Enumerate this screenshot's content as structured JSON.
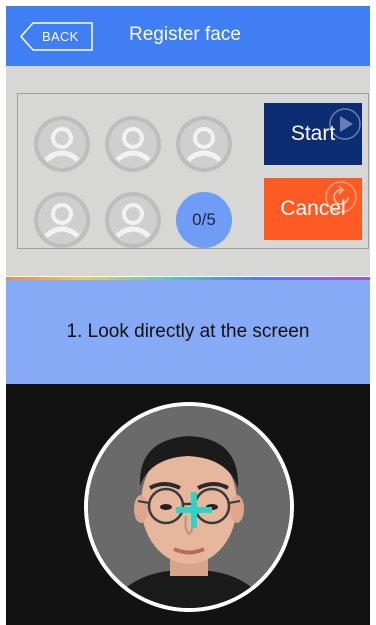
{
  "header": {
    "back_label": "BACK",
    "title": "Register face"
  },
  "capture": {
    "slots_total": 5,
    "captured": 0,
    "counter_text": "0/5"
  },
  "buttons": {
    "start_label": "Start",
    "cancel_label": "Cancel"
  },
  "instruction": {
    "text": "1. Look directly at the screen"
  },
  "icons": {
    "back": "back-arrow-icon",
    "slot": "person-avatar-icon",
    "start_overlay": "play-icon",
    "cancel_overlay": "refresh-icon",
    "crosshair": "crosshair-icon"
  },
  "colors": {
    "header": "#3f7ef3",
    "panel": "#d7d7d6",
    "start_button": "#0d2d72",
    "cancel_button": "#fd5a24",
    "counter": "#6f9cf4",
    "instruction_band": "#86aaf6",
    "camera_bg": "#121212",
    "crosshair": "#2fd4c8"
  }
}
